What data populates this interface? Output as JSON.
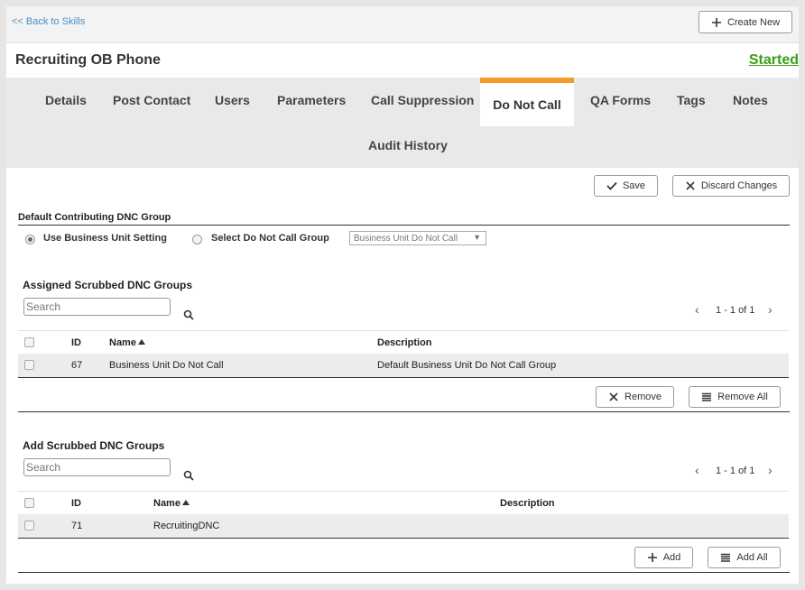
{
  "topbar": {
    "back_link": "<< Back to Skills",
    "create_new": "Create New"
  },
  "header": {
    "title": "Recruiting OB Phone",
    "status": "Started"
  },
  "tabs": [
    "Details",
    "Post Contact",
    "Users",
    "Parameters",
    "Call Suppression",
    "Do Not Call",
    "QA Forms",
    "Tags",
    "Notes",
    "Audit History"
  ],
  "active_tab": "Do Not Call",
  "actions": {
    "save": "Save",
    "discard": "Discard Changes"
  },
  "default_group": {
    "label": "Default Contributing DNC Group",
    "option_business_unit": "Use Business Unit Setting",
    "option_select": "Select Do Not Call Group",
    "selected_option": "Use Business Unit Setting",
    "dropdown_value": "Business Unit Do Not Call"
  },
  "assigned": {
    "title": "Assigned Scrubbed DNC Groups",
    "search_placeholder": "Search",
    "pager": "1 - 1 of 1",
    "columns": {
      "id": "ID",
      "name": "Name",
      "description": "Description"
    },
    "rows": [
      {
        "id": "67",
        "name": "Business Unit Do Not Call",
        "description": "Default Business Unit Do Not Call Group"
      }
    ],
    "remove": "Remove",
    "remove_all": "Remove All"
  },
  "add": {
    "title": "Add Scrubbed DNC Groups",
    "search_placeholder": "Search",
    "pager": "1 - 1 of 1",
    "columns": {
      "id": "ID",
      "name": "Name",
      "description": "Description"
    },
    "rows": [
      {
        "id": "71",
        "name": "RecruitingDNC",
        "description": ""
      }
    ],
    "add": "Add",
    "add_all": "Add All"
  },
  "colors": {
    "accent_tab": "#f79a2e",
    "status_green": "#3aa014",
    "link_blue": "#4a90c8"
  }
}
